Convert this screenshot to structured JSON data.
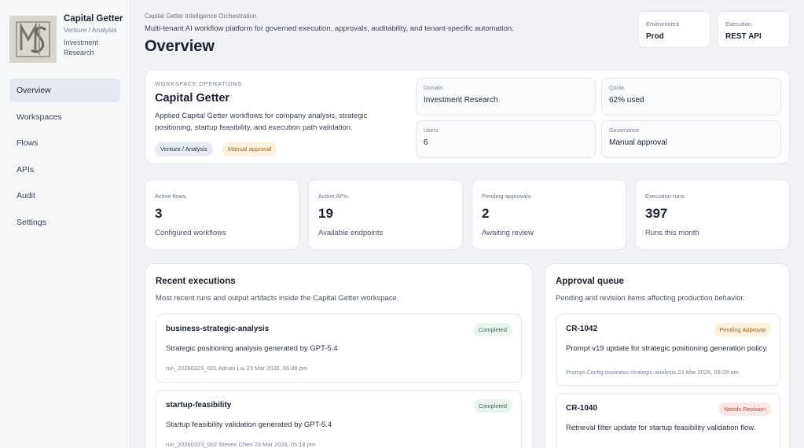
{
  "brand": {
    "name": "Capital Getter",
    "sub": "Venture / Analysis",
    "sub2": "Investment Research"
  },
  "nav": [
    {
      "label": "Overview",
      "active": true
    },
    {
      "label": "Workspaces"
    },
    {
      "label": "Flows"
    },
    {
      "label": "APIs"
    },
    {
      "label": "Audit"
    },
    {
      "label": "Settings"
    }
  ],
  "header": {
    "eyebrow": "Capital Getter Intelligence Orchestration",
    "desc": "Multi-tenant AI workflow platform for governed execution, approvals, auditability, and tenant-specific automation.",
    "title": "Overview",
    "environment": {
      "label": "Environment",
      "value": "Prod"
    },
    "execution": {
      "label": "Execution",
      "value": "REST API"
    }
  },
  "workspace": {
    "eyebrow": "WORKSPACE OPERATIONS",
    "title": "Capital Getter",
    "desc": "Applied Capital Getter workflows for company analysis, strategic positioning, startup feasibility, and execution path validation.",
    "chips": [
      "Venture / Analysis",
      "Manual approval"
    ],
    "fields": [
      {
        "label": "Domain",
        "value": "Investment Research"
      },
      {
        "label": "Quota",
        "value": "62% used"
      },
      {
        "label": "Users",
        "value": "6"
      },
      {
        "label": "Governance",
        "value": "Manual approval"
      }
    ]
  },
  "stats": [
    {
      "label": "Active flows",
      "value": "3",
      "sub": "Configured workflows"
    },
    {
      "label": "Active APIs",
      "value": "19",
      "sub": "Available endpoints"
    },
    {
      "label": "Pending approvals",
      "value": "2",
      "sub": "Awaiting review"
    },
    {
      "label": "Execution runs",
      "value": "397",
      "sub": "Runs this month"
    }
  ],
  "executions": {
    "title": "Recent executions",
    "sub": "Most recent runs and output artifacts inside the Capital Getter workspace.",
    "items": [
      {
        "title": "business-strategic-analysis",
        "status": "Completed",
        "desc": "Strategic positioning analysis generated by GPT-5.4",
        "meta": "run_20260323_001  Adrian Liu  23 Mar 2026, 06:48 pm"
      },
      {
        "title": "startup-feasibility",
        "status": "Completed",
        "desc": "Startup feasibility validation generated by GPT-5.4",
        "meta": "run_20260323_002  Steven Chen  23 Mar 2026, 05:18 pm"
      }
    ]
  },
  "approvals": {
    "title": "Approval queue",
    "sub": "Pending and revision items affecting production behavior.",
    "items": [
      {
        "title": "CR-1042",
        "status": "Pending Approval",
        "desc": "Prompt v19 update for strategic positioning generation policy.",
        "meta": "Prompt Config  business-strategic-analysis  23 Mar 2026, 09:28 am"
      },
      {
        "title": "CR-1040",
        "status": "Needs Revision",
        "desc": "Retrieval filter update for startup feasibility validation flow.",
        "meta": ""
      }
    ]
  },
  "colors": {
    "completed": "#2f7a4b",
    "pending": "#9b6516",
    "revision": "#b2433a"
  }
}
